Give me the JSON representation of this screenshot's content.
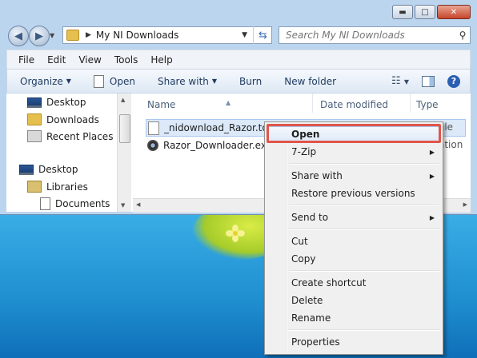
{
  "window": {
    "controls": {
      "minimize": "▬",
      "maximize": "□",
      "close": "✕"
    }
  },
  "nav": {
    "back": "◀",
    "forward": "▶",
    "address": {
      "path_segment": "My NI Downloads"
    },
    "search_placeholder": "Search My NI Downloads"
  },
  "menubar": [
    "File",
    "Edit",
    "View",
    "Tools",
    "Help"
  ],
  "toolbar": {
    "organize": "Organize",
    "open": "Open",
    "share_with": "Share with",
    "burn": "Burn",
    "new_folder": "New folder"
  },
  "navpane": {
    "items": [
      {
        "label": "Desktop",
        "icon": "desktop-icon"
      },
      {
        "label": "Downloads",
        "icon": "folder-icon"
      },
      {
        "label": "Recent Places",
        "icon": "recent-places-icon"
      },
      {
        "label": "Desktop",
        "icon": "desktop-icon"
      },
      {
        "label": "Libraries",
        "icon": "libraries-icon"
      },
      {
        "label": "Documents",
        "icon": "documents-icon"
      }
    ]
  },
  "columns": {
    "name": "Name",
    "date_modified": "Date modified",
    "type": "Type"
  },
  "files": [
    {
      "name": "_nidownload_Razor.toc",
      "type_fragment": "ile"
    },
    {
      "name": "Razor_Downloader.exe",
      "type_fragment": "ation"
    }
  ],
  "context_menu": {
    "open": "Open",
    "seven_zip": "7-Zip",
    "share_with": "Share with",
    "restore_previous_versions": "Restore previous versions",
    "send_to": "Send to",
    "cut": "Cut",
    "copy": "Copy",
    "create_shortcut": "Create shortcut",
    "delete": "Delete",
    "rename": "Rename",
    "properties": "Properties"
  },
  "colors": {
    "highlight_border": "#e0564b",
    "desktop_blue": "#2c9fd8"
  }
}
